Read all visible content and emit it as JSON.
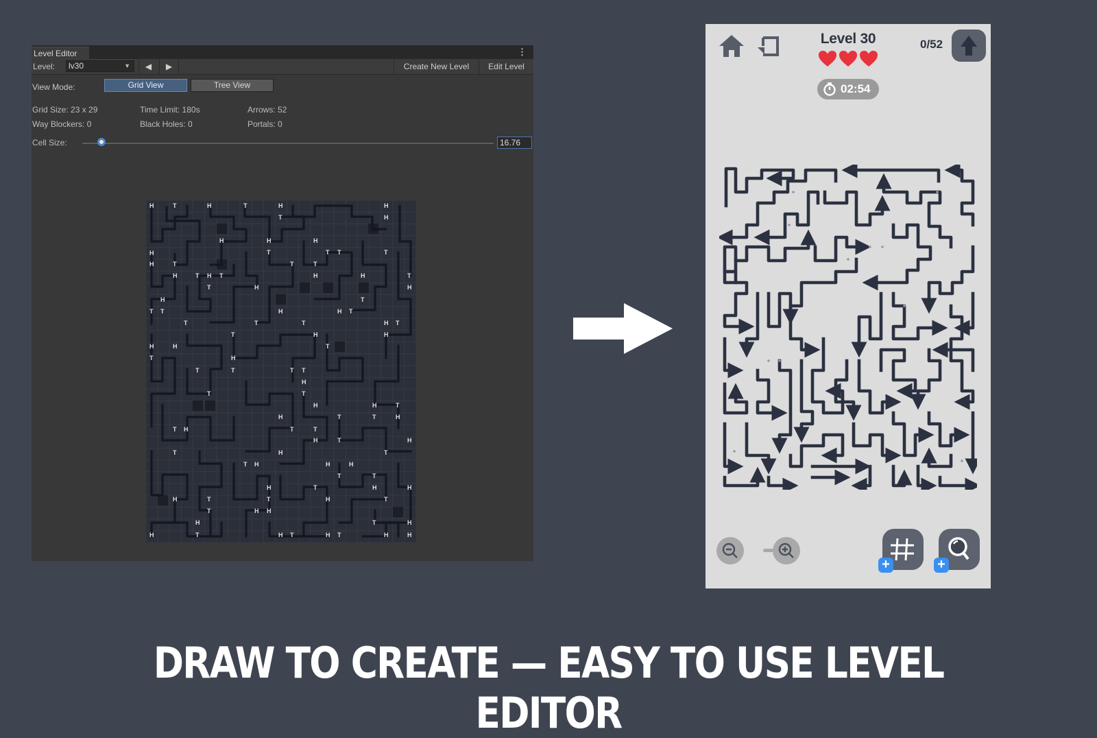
{
  "editor": {
    "window_title": "Level Editor",
    "menu_icon": "kebab-menu-icon",
    "level_label": "Level:",
    "level_value": "lv30",
    "prev_glyph": "◀",
    "next_glyph": "▶",
    "create_new_level": "Create New Level",
    "edit_level": "Edit Level",
    "view_mode_label": "View Mode:",
    "view_modes": {
      "grid": "Grid View",
      "tree": "Tree View"
    },
    "stats": {
      "grid_size": "Grid Size: 23 x 29",
      "time_limit": "Time Limit: 180s",
      "arrows": "Arrows: 52",
      "way_blockers": "Way Blockers: 0",
      "black_holes": "Black Holes: 0",
      "portals": "Portals: 0"
    },
    "cell_size_label": "Cell Size:",
    "cell_size_value": "16.76",
    "grid": {
      "cols": 23,
      "rows": 29
    }
  },
  "game": {
    "level_title": "Level 30",
    "lives": 3,
    "progress": "0/52",
    "timer": "02:54",
    "accent_heart": "#e8323c",
    "accent_plus": "#3b8ff0",
    "maze_color": "#2b3140"
  },
  "caption": "DRAW TO CREATE — EASY TO USE LEVEL EDITOR"
}
